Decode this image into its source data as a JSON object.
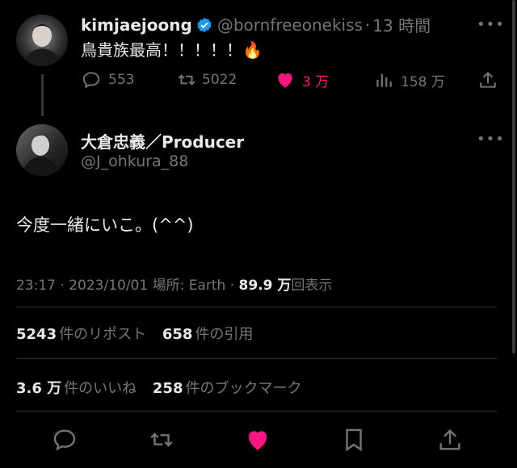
{
  "parent_tweet": {
    "display_name": "kimjaejoong",
    "handle": "@bornfreeonekiss",
    "separator": "·",
    "time": "13 時間",
    "text": "鳥貴族最高！！！！！🔥",
    "replies": "553",
    "retweets": "5022",
    "likes": "3 万",
    "views": "158 万"
  },
  "main_tweet": {
    "display_name": "大倉忠義／Producer",
    "handle": "@J_ohkura_88",
    "text": "今度一緒にいこ。(^^)",
    "meta_time": "23:17 · 2023/10/01 場所: Earth · ",
    "meta_views_num": "89.9 万",
    "meta_views_label": "回表示"
  },
  "stats": {
    "reposts_num": "5243",
    "reposts_label": "件のリポスト",
    "quotes_num": "658",
    "quotes_label": "件の引用",
    "likes_num": "3.6 万",
    "likes_label": "件のいいね",
    "bookmarks_num": "258",
    "bookmarks_label": "件のブックマーク"
  },
  "more_label": "•••",
  "colors": {
    "background": "#000000",
    "text": "#e7e9ea",
    "secondary": "#71767b",
    "like_pink": "#f91880",
    "verified_blue": "#1d9bf0",
    "divider": "#2f3336"
  },
  "icons": [
    "verified-badge-icon",
    "reply-icon",
    "retweet-icon",
    "heart-icon",
    "views-icon",
    "share-icon",
    "bookmark-icon",
    "more-icon",
    "fire-emoji"
  ]
}
